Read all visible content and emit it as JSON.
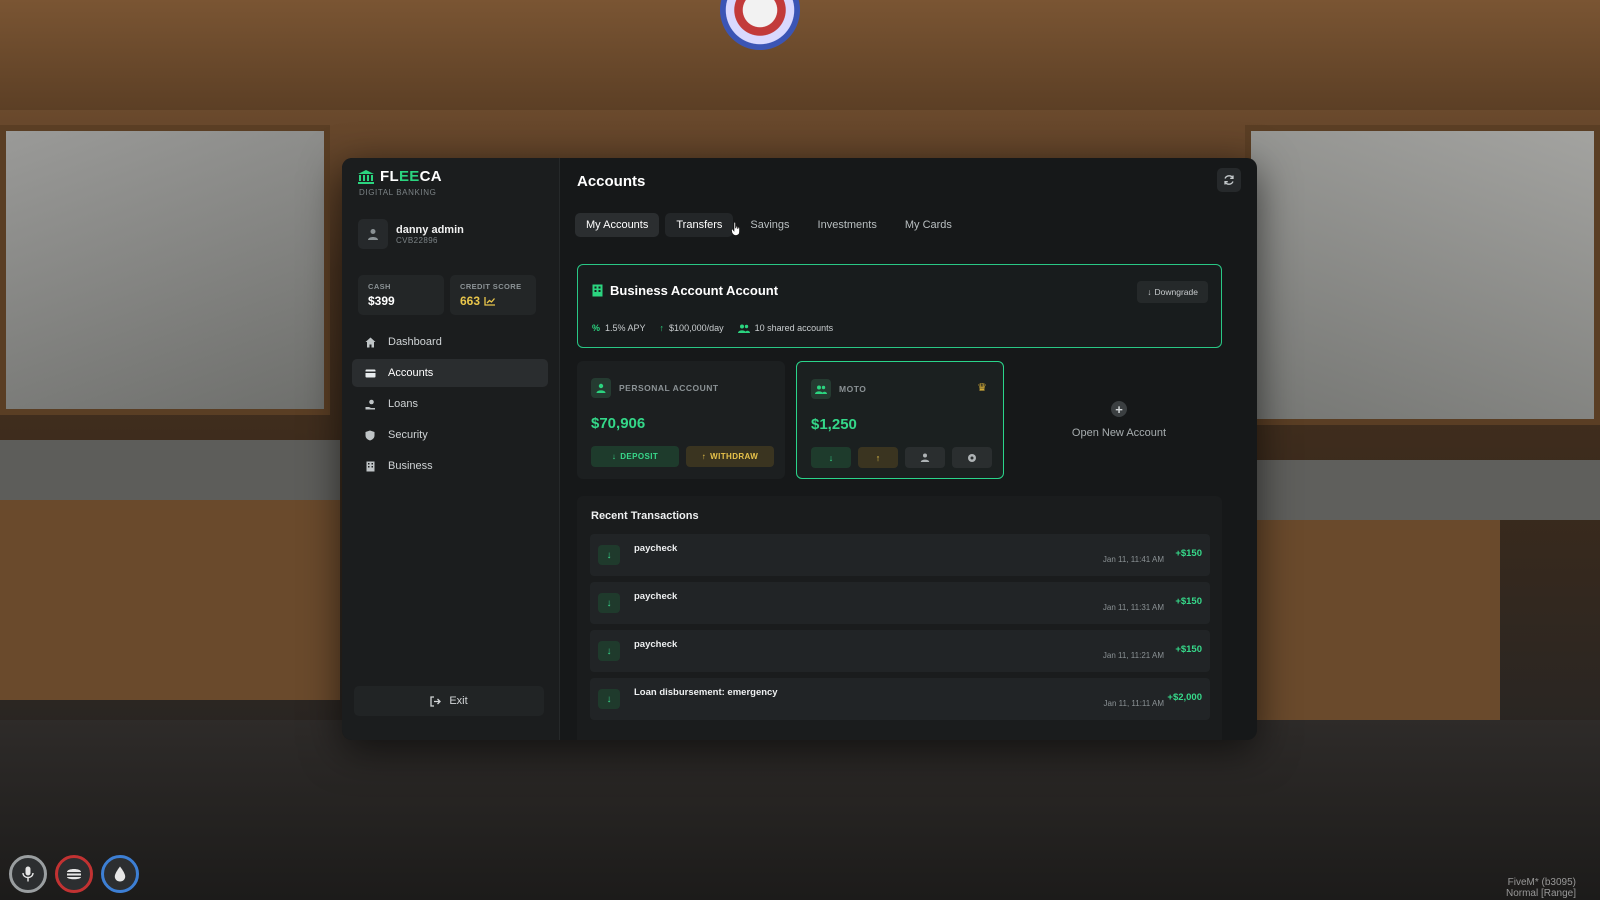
{
  "brand": {
    "name_prefix": "FL",
    "name_accent": "EE",
    "name_suffix": "CA",
    "subtitle": "DIGITAL BANKING"
  },
  "user": {
    "name": "danny admin",
    "id": "CVB22896"
  },
  "stats": {
    "cash": {
      "label": "CASH",
      "value": "$399"
    },
    "credit": {
      "label": "CREDIT SCORE",
      "value": "663"
    }
  },
  "nav": [
    {
      "label": "Dashboard",
      "icon": "home-icon"
    },
    {
      "label": "Accounts",
      "icon": "card-icon"
    },
    {
      "label": "Loans",
      "icon": "hand-coin-icon"
    },
    {
      "label": "Security",
      "icon": "shield-icon"
    },
    {
      "label": "Business",
      "icon": "building-icon"
    }
  ],
  "exit_label": "Exit",
  "header": {
    "title": "Accounts"
  },
  "tabs": [
    {
      "label": "My Accounts",
      "state": "active"
    },
    {
      "label": "Transfers",
      "state": "hover"
    },
    {
      "label": "Savings",
      "state": ""
    },
    {
      "label": "Investments",
      "state": ""
    },
    {
      "label": "My Cards",
      "state": ""
    }
  ],
  "business": {
    "title": "Business Account Account",
    "downgrade_label": "Downgrade",
    "apy": "1.5% APY",
    "limit": "$100,000/day",
    "shared": "10 shared accounts"
  },
  "accounts": [
    {
      "name": "PERSONAL ACCOUNT",
      "balance": "$70,906",
      "deposit_label": "DEPOSIT",
      "withdraw_label": "WITHDRAW"
    },
    {
      "name": "MOTO",
      "balance": "$1,250"
    }
  ],
  "open_new_label": "Open New Account",
  "transactions": {
    "title": "Recent Transactions",
    "items": [
      {
        "name": "paycheck",
        "date": "Jan 11, 11:41 AM",
        "amount": "+$150"
      },
      {
        "name": "paycheck",
        "date": "Jan 11, 11:31 AM",
        "amount": "+$150"
      },
      {
        "name": "paycheck",
        "date": "Jan 11, 11:21 AM",
        "amount": "+$150"
      },
      {
        "name": "Loan disbursement: emergency",
        "date": "Jan 11, 11:11 AM",
        "amount": "+$2,000"
      }
    ]
  },
  "watermark": {
    "line1": "FiveM* (b3095)",
    "line2": "Normal [Range]"
  },
  "colors": {
    "accent_green": "#2bd47f",
    "accent_gold": "#e7c24a",
    "panel_bg": "#161819"
  }
}
